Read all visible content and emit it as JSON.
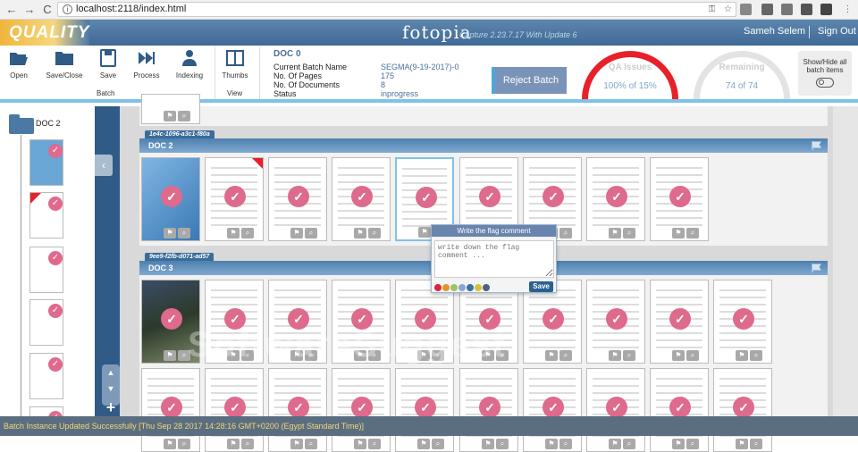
{
  "browser": {
    "url": "localhost:2118/index.html",
    "back": "←",
    "forward": "→",
    "reload": "C"
  },
  "app": {
    "badge": "QUALITY",
    "logo": "fotopia",
    "version": "Capture 2.23.7.17 With Update 6",
    "user": "Sameh Selem",
    "sign_out": "Sign Out"
  },
  "toolbar": {
    "open": "Open",
    "save_close": "Save/Close",
    "save": "Save",
    "process": "Process",
    "indexing": "Indexing",
    "batch_group": "Batch",
    "thumbs": "Thumbs",
    "view_group": "View"
  },
  "doc": {
    "title": "DOC 0",
    "rows": [
      {
        "k": "Current Batch Name",
        "v": "SEGMA(9-19-2017)-0"
      },
      {
        "k": "No. Of Pages",
        "v": "175"
      },
      {
        "k": "No. Of Documents",
        "v": "8"
      },
      {
        "k": "Status",
        "v": "inprogress"
      }
    ]
  },
  "reject_batch": "Reject Batch",
  "qa": {
    "label": "QA Issues",
    "value": "100% of 15%"
  },
  "remaining": {
    "label": "Remaining",
    "value": "74 of 74"
  },
  "show_hide": "Show/Hide all batch items",
  "sidebar": {
    "doc_label": "DOC 2"
  },
  "batches": [
    {
      "tag": "1e4c-1096-a3c1-f80a",
      "label": "DOC 2"
    },
    {
      "tag": "9ee9-f2fb-d071-ad57",
      "label": "DOC 3"
    }
  ],
  "flag_popup": {
    "title": "Write the flag comment",
    "placeholder": "write down the flag comment ...",
    "save": "Save",
    "colors": [
      "#d9263a",
      "#e8912a",
      "#9cc26b",
      "#8aa7d0",
      "#3a6fa8",
      "#d7c13b",
      "#4f6080"
    ]
  },
  "status_message": "Batch Instance Updated Successfully [Thu Sep 28 2017 14:28:16 GMT+0200 (Egypt Standard Time)]",
  "watermark": "SoftwareSuggest",
  "colors": {
    "accent": "#3f6a96",
    "check": "#de6a8c",
    "flag": "#e8202a"
  }
}
